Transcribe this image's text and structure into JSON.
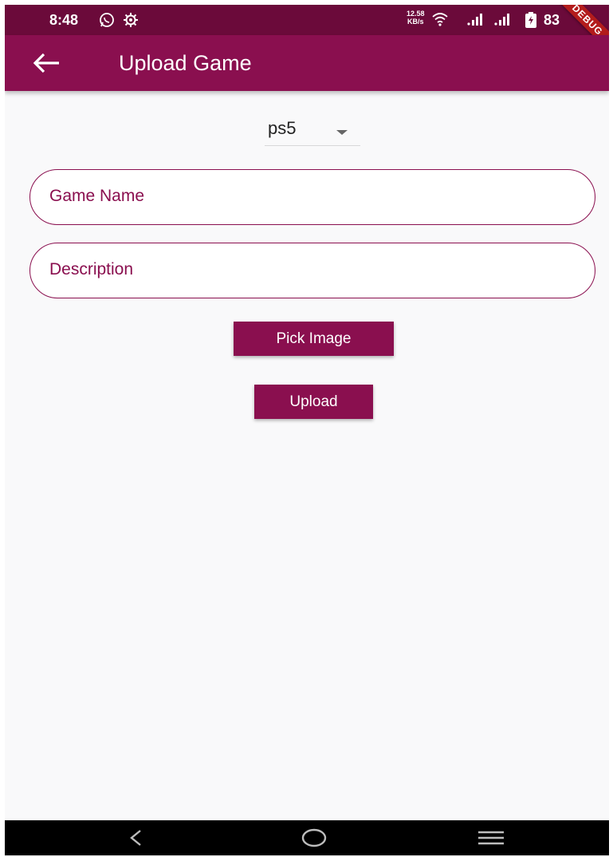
{
  "status_bar": {
    "time": "8:48",
    "network_speed_value": "12.58",
    "network_speed_unit": "KB/s",
    "battery": "83",
    "icons": [
      "whatsapp-icon",
      "settings-gear-icon",
      "wifi-icon",
      "signal-icon",
      "signal-icon",
      "battery-charging-icon"
    ]
  },
  "debug_banner": "DEBUG",
  "app_bar": {
    "title": "Upload Game",
    "back_icon": "arrow-back-icon"
  },
  "platform_dropdown": {
    "selected": "ps5"
  },
  "form": {
    "game_name_placeholder": "Game Name",
    "description_placeholder": "Description"
  },
  "buttons": {
    "pick_image": "Pick Image",
    "upload": "Upload"
  },
  "nav_bar": {
    "icons": [
      "back-nav-icon",
      "home-nav-icon",
      "recents-nav-icon"
    ]
  },
  "colors": {
    "primary": "#8a0f4f",
    "status_bar": "#6b0a3a",
    "background": "#f9f9fa"
  }
}
